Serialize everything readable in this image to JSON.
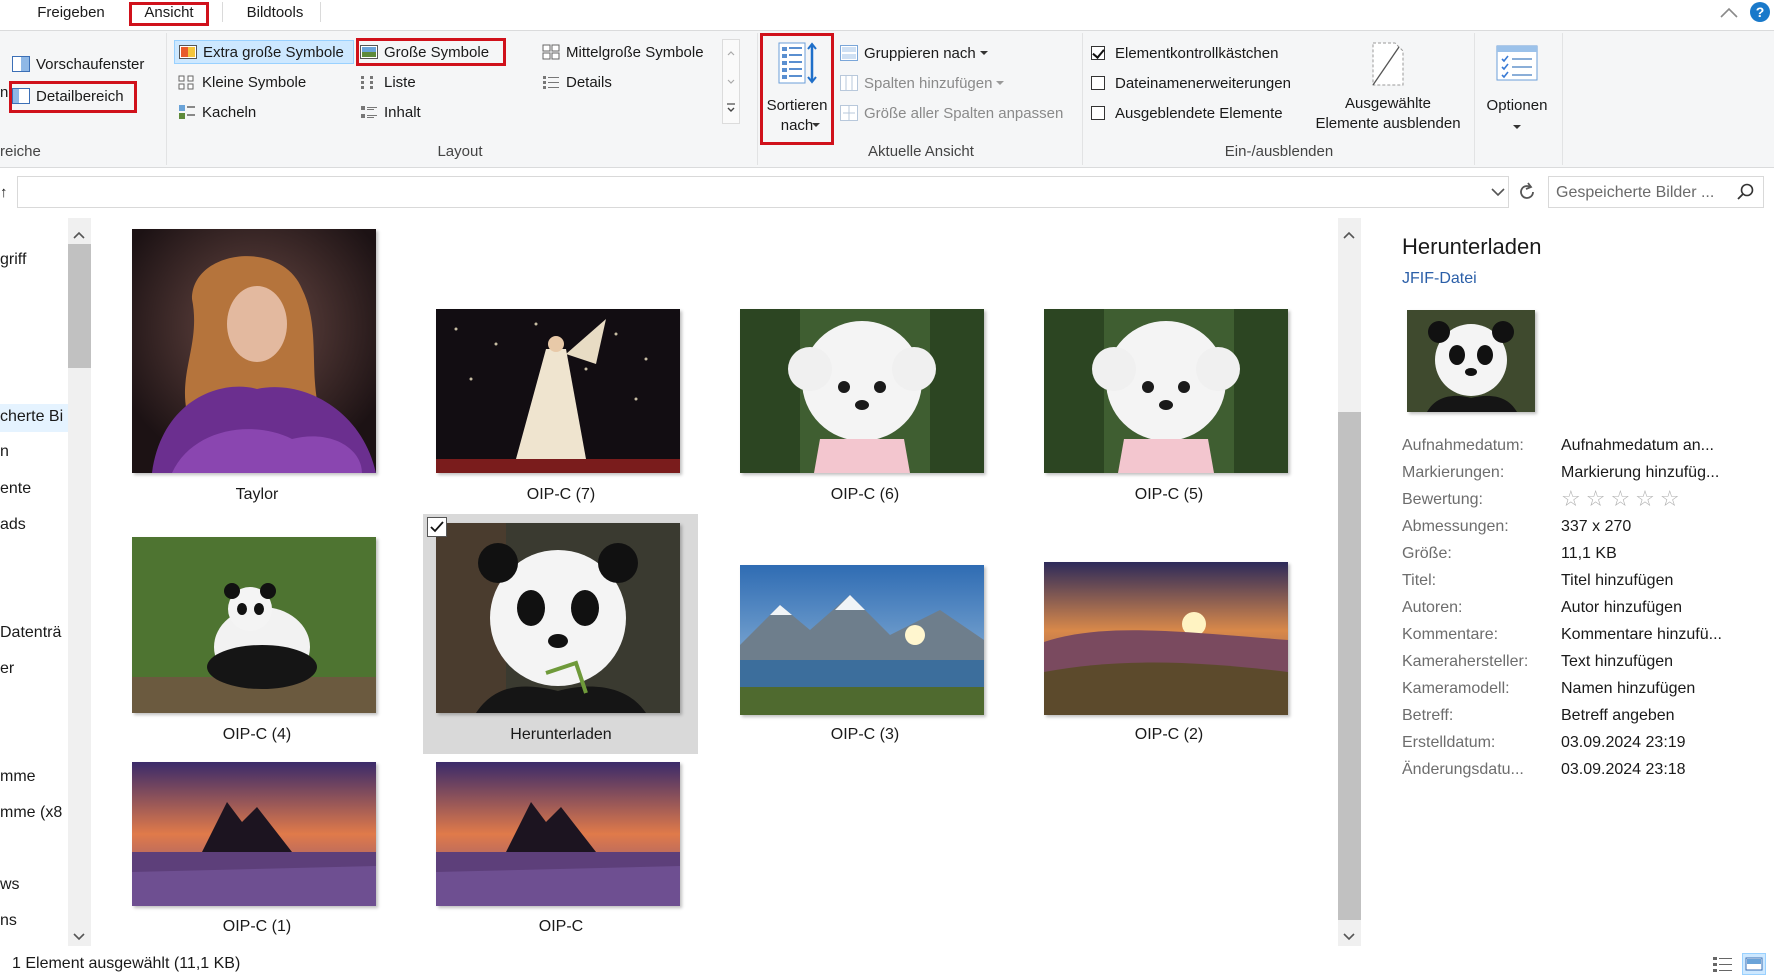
{
  "tabs": [
    {
      "label": "Freigeben"
    },
    {
      "label": "Ansicht"
    },
    {
      "label": "Bildtools"
    }
  ],
  "ribbon": {
    "panes": {
      "preview_label": "Vorschaufenster",
      "details_label": "Detailbereich",
      "group_label": "reiche",
      "cut_label": "n"
    },
    "layout": {
      "items": [
        {
          "label": "Extra große Symbole"
        },
        {
          "label": "Große Symbole"
        },
        {
          "label": "Mittelgroße Symbole"
        },
        {
          "label": "Kleine Symbole"
        },
        {
          "label": "Liste"
        },
        {
          "label": "Details"
        },
        {
          "label": "Kacheln"
        },
        {
          "label": "Inhalt"
        }
      ],
      "group_label": "Layout"
    },
    "current_view": {
      "sort_label_1": "Sortieren",
      "sort_label_2": "nach",
      "group_by": "Gruppieren nach",
      "add_columns": "Spalten hinzufügen",
      "size_columns": "Größe aller Spalten anpassen",
      "group_label": "Aktuelle Ansicht"
    },
    "show_hide": {
      "item_checkboxes": "Elementkontrollkästchen",
      "file_extensions": "Dateinamenerweiterungen",
      "hidden_items": "Ausgeblendete Elemente",
      "hide_selected_1": "Ausgewählte",
      "hide_selected_2": "Elemente ausblenden",
      "group_label": "Ein-/ausblenden"
    },
    "options_label": "Optionen"
  },
  "address": {
    "search_placeholder": "Gespeicherte Bilder ..."
  },
  "nav": {
    "items": [
      {
        "label": "griff"
      },
      {
        "label": "cherte Bi"
      },
      {
        "label": "n"
      },
      {
        "label": "ente"
      },
      {
        "label": "ads"
      },
      {
        "label": "Datenträ"
      },
      {
        "label": "er"
      },
      {
        "label": "mme"
      },
      {
        "label": "mme (x8"
      },
      {
        "label": "ws"
      },
      {
        "label": "ns"
      }
    ]
  },
  "files": [
    {
      "name": "Taylor"
    },
    {
      "name": "OIP-C (7)"
    },
    {
      "name": "OIP-C (6)"
    },
    {
      "name": "OIP-C (5)"
    },
    {
      "name": "OIP-C (4)"
    },
    {
      "name": "Herunterladen"
    },
    {
      "name": "OIP-C (3)"
    },
    {
      "name": "OIP-C (2)"
    },
    {
      "name": "OIP-C (1)"
    },
    {
      "name": "OIP-C"
    }
  ],
  "details": {
    "title": "Herunterladen",
    "type": "JFIF-Datei",
    "properties": [
      {
        "label": "Aufnahmedatum:",
        "value": "Aufnahmedatum an..."
      },
      {
        "label": "Markierungen:",
        "value": "Markierung hinzufüg..."
      },
      {
        "label": "Bewertung:",
        "value": "☆☆☆☆☆"
      },
      {
        "label": "Abmessungen:",
        "value": "337 x 270"
      },
      {
        "label": "Größe:",
        "value": "11,1 KB"
      },
      {
        "label": "Titel:",
        "value": "Titel hinzufügen"
      },
      {
        "label": "Autoren:",
        "value": "Autor hinzufügen"
      },
      {
        "label": "Kommentare:",
        "value": "Kommentare hinzufü..."
      },
      {
        "label": "Kamerahersteller:",
        "value": "Text hinzufügen"
      },
      {
        "label": "Kameramodell:",
        "value": "Namen hinzufügen"
      },
      {
        "label": "Betreff:",
        "value": "Betreff angeben"
      },
      {
        "label": "Erstelldatum:",
        "value": "03.09.2024 23:19"
      },
      {
        "label": "Änderungsdatu...",
        "value": "03.09.2024 23:18"
      }
    ]
  },
  "status": {
    "text": "1 Element ausgewählt (11,1 KB)"
  },
  "colors": {
    "highlight_red": "#d0111b",
    "selection_blue": "#cde8ff",
    "accent_blue": "#0063b1"
  }
}
